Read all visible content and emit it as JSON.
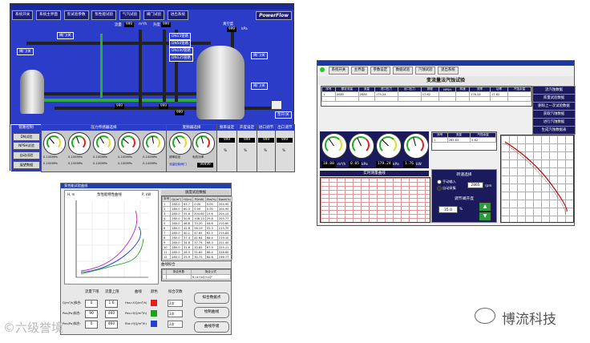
{
  "scada": {
    "nav": [
      "系统开关",
      "系统主界面",
      "泵试验参数",
      "泵性能试验",
      "气汽试验",
      "阀门试验",
      "进出系统"
    ],
    "logo": "PowerFlow",
    "top_tags": [
      {
        "text": "流量",
        "value": "999"
      },
      {
        "text": "m³/h",
        "value": ""
      },
      {
        "text": "升度",
        "value": "999"
      },
      {
        "text": "真空度",
        "value": "999"
      },
      {
        "text": "kPa",
        "value": ""
      }
    ],
    "side_tags": [
      "DN15管路",
      "DN50管路",
      "DN100管路",
      "DN125管路"
    ],
    "valve_tag": "阀门/关",
    "pump_tag": "泵开/关",
    "readouts": [
      "999",
      "999",
      "999",
      "999",
      "999",
      "999",
      "999"
    ],
    "left_menu": {
      "title": "管路控制",
      "items": [
        "DN试验",
        "NPSH试验",
        "自动试验",
        "展望数据"
      ]
    },
    "panels": [
      {
        "title": "压力传感器选择",
        "labels": [
          "0-100MPa",
          "0-100MPa",
          "0-100MPa",
          "0-100MPa",
          "0-100MPa",
          "0-100MPa",
          "0-100MPa",
          "0-100MPa",
          "0-100MPa",
          "0-100MPa"
        ]
      },
      {
        "title": "变频器选择",
        "labels": [
          "频率给定",
          "电机功率",
          "流量控制阀门"
        ]
      },
      {
        "title": "频率设定",
        "value": "999"
      },
      {
        "title": "开度设定",
        "value": "999"
      },
      {
        "title": "进口调节",
        "value": "999"
      },
      {
        "title": "出口调节",
        "value": "999"
      }
    ],
    "pct": "%",
    "mhz_value": "99999"
  },
  "test2": {
    "toolbar": [
      "系统开关",
      "主界面",
      "参数设定",
      "数据试验",
      "汽蚀试验",
      "退出系统"
    ],
    "title": "变流量法汽蚀试验",
    "sidebar": [
      "流汽蚀数据",
      "库量试验数据",
      "删除上一次试验数据",
      "获取汽蚀数据",
      "进行汽蚀数据",
      "生成汽蚀数据表"
    ],
    "table_headers": [
      "序号",
      "额定流量",
      "流量",
      "进口压力",
      "出口压力",
      "扬程",
      "NPSH",
      "转速",
      "效率",
      "功率",
      "汽蚀余量"
    ],
    "table_row": [
      "1",
      "2885",
      "2885",
      "175.24",
      "",
      "17.62",
      "",
      "",
      "176.24",
      "17.62",
      ""
    ],
    "readouts": [
      {
        "value": "10.80",
        "unit": "m³/h"
      },
      {
        "value": "0.05",
        "unit": "kPa"
      },
      {
        "value": "179.24",
        "unit": "kPa"
      },
      {
        "value": "1.76",
        "unit": "kW"
      }
    ],
    "chart_title": "实时测量曲线",
    "speed_label": "转速选择",
    "speed_options": [
      "手动输入",
      "自动采集"
    ],
    "speed_value": "2865",
    "speed_unit": "rpm",
    "valve_label": "调节阀开度",
    "valve_value": "35.0",
    "valve_unit": "%",
    "mini_table_headers": [
      "序号",
      "流量",
      "汽蚀余量"
    ],
    "mini_table_row": [
      "1",
      "285.63",
      "5.62"
    ]
  },
  "pump_curve": {
    "window_title": "泵性能试验曲线",
    "chart_title": "泵性能特性曲线",
    "y_label": "H, m",
    "right_label": "P, kW",
    "table_title": "速度试验数据",
    "headers": [
      "序号",
      "Q/(m³)",
      "H/(m)",
      "P/(kW)",
      "Eta(%)",
      "Npsh(%)"
    ],
    "rows": [
      [
        "1",
        "280.0",
        "63.7",
        "0.00",
        "0.00",
        "204.90"
      ],
      [
        "2",
        "280.0",
        "60.5",
        "0.00",
        "0.00",
        "204.90"
      ],
      [
        "3",
        "280.0",
        "55.6",
        "204.60",
        "15.6",
        "204.10"
      ],
      [
        "4",
        "280.0",
        "50.6",
        "108.23",
        "29.8",
        "205.77"
      ],
      [
        "5",
        "280.0",
        "46.8",
        "70.20",
        "44.6",
        "210.60"
      ],
      [
        "6",
        "280.0",
        "42.8",
        "56.19",
        "55.3",
        "213.70"
      ],
      [
        "7",
        "280.0",
        "40.1",
        "47.65",
        "62.5",
        "215.84"
      ],
      [
        "8",
        "280.0",
        "37.4",
        "41.64",
        "66.4",
        "219.10"
      ],
      [
        "9",
        "280.0",
        "34.8",
        "37.74",
        "68.3",
        "221.40"
      ],
      [
        "10",
        "280.0",
        "31.6",
        "33.85",
        "67.9",
        "225.11"
      ],
      [
        "11",
        "280.0",
        "28.5",
        "31.65",
        "66.4",
        "228.60"
      ],
      [
        "12",
        "280.0",
        "25.9",
        "30.75",
        "64.6",
        "236.77"
      ]
    ],
    "fit_label": "曲线拟合",
    "fit_headers": [
      "",
      "拟合系数",
      "拟合公式"
    ],
    "fit_value": "H=a+bQ+cQ²",
    "range_title": "流量下限",
    "range_upper": "流量上限",
    "curve_label": "曲线",
    "color_label": "颜色",
    "order_label": "拟合次数",
    "inputs": [
      {
        "label": "Q/m³/h]拟合:",
        "lo": "0",
        "hi": "1.6"
      },
      {
        "label": "Pos(Pa)拟合:",
        "lo": "90",
        "hi": "460"
      },
      {
        "label": "Pos(Pa)拟合:",
        "lo": "0",
        "hi": "460"
      }
    ],
    "curve_names": [
      "Hss=f(Q/m³/h)",
      "Pos=f(Q/m³/h)",
      "Eta=f(Q/m³/h)"
    ],
    "swatch_colors": [
      "#e02020",
      "#20a020",
      "#2040d0"
    ],
    "order_values": [
      "2次",
      "3次",
      "2次"
    ],
    "buttons": [
      "拟合数据点",
      "绘制曲线",
      "曲线存储"
    ]
  },
  "watermark_left": "©六级誉境",
  "watermark_right": "博流科技"
}
